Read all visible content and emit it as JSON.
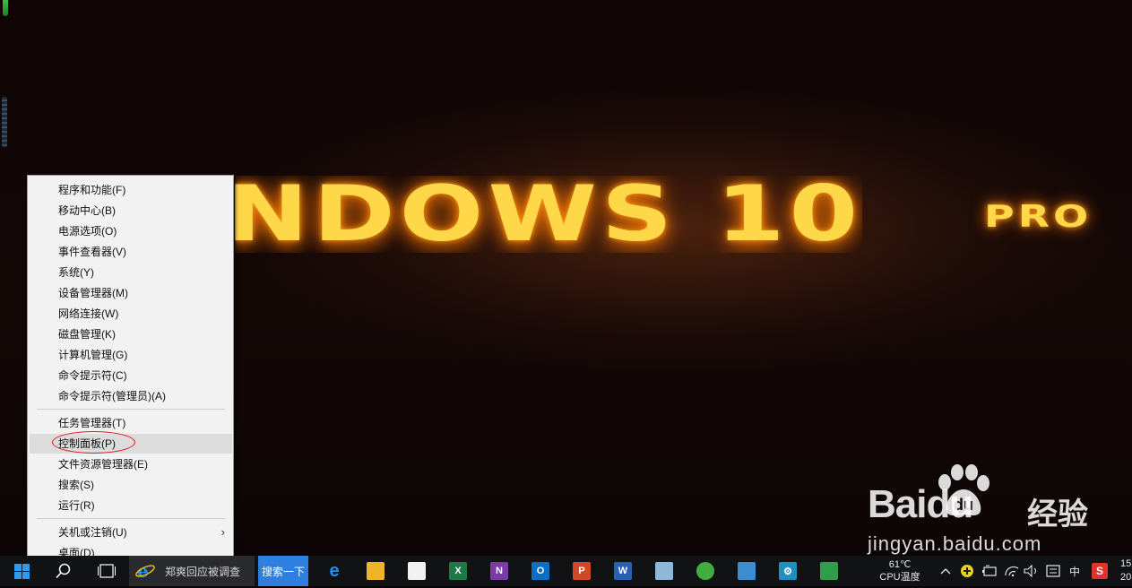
{
  "wallpaper": {
    "title": "NDOWS 10",
    "edition": "PRO"
  },
  "context_menu": {
    "groups": [
      [
        {
          "label": "程序和功能(F)"
        },
        {
          "label": "移动中心(B)"
        },
        {
          "label": "电源选项(O)"
        },
        {
          "label": "事件查看器(V)"
        },
        {
          "label": "系统(Y)"
        },
        {
          "label": "设备管理器(M)"
        },
        {
          "label": "网络连接(W)"
        },
        {
          "label": "磁盘管理(K)"
        },
        {
          "label": "计算机管理(G)"
        },
        {
          "label": "命令提示符(C)"
        },
        {
          "label": "命令提示符(管理员)(A)"
        }
      ],
      [
        {
          "label": "任务管理器(T)"
        },
        {
          "label": "控制面板(P)",
          "selected": true
        },
        {
          "label": "文件资源管理器(E)"
        },
        {
          "label": "搜索(S)"
        },
        {
          "label": "运行(R)"
        }
      ],
      [
        {
          "label": "关机或注销(U)",
          "has_submenu": true
        },
        {
          "label": "桌面(D)"
        }
      ]
    ],
    "submenu_arrow": "›"
  },
  "taskbar": {
    "start_icon": "windows-logo-icon",
    "search_icon": "magnifier-icon",
    "task_view_icon": "task-view-icon",
    "ie_window_label": "郑爽回应被调查",
    "search_button_label": "搜索一下",
    "pinned_apps": [
      {
        "name": "edge",
        "glyph": "e",
        "color": "#1e90ff"
      },
      {
        "name": "file-explorer",
        "glyph": "",
        "color": "#f0b429"
      },
      {
        "name": "store",
        "glyph": "",
        "color": "#f2f2f2"
      },
      {
        "name": "excel",
        "glyph": "X",
        "color": "#1d7a45"
      },
      {
        "name": "onenote",
        "glyph": "N",
        "color": "#7d3ba8"
      },
      {
        "name": "outlook",
        "glyph": "O",
        "color": "#0b6fc6"
      },
      {
        "name": "powerpoint",
        "glyph": "P",
        "color": "#d24726"
      },
      {
        "name": "word",
        "glyph": "W",
        "color": "#2b5fb4"
      },
      {
        "name": "paint",
        "glyph": "",
        "color": "#8fb8d8"
      },
      {
        "name": "green-app",
        "glyph": "",
        "color": "#3fae3f"
      },
      {
        "name": "remote-app",
        "glyph": "",
        "color": "#3a8dd0"
      },
      {
        "name": "settings",
        "glyph": "⚙",
        "color": "#1f8fc0"
      },
      {
        "name": "image-app",
        "glyph": "",
        "color": "#2e9e4a"
      }
    ],
    "cpu_temp_value": "61℃",
    "cpu_temp_label": "CPU温度",
    "tray": {
      "chevron": "^",
      "ime": "中",
      "sogou": "S"
    },
    "clock_time": "15",
    "clock_date": "20"
  },
  "watermark": {
    "brand": "Baidu",
    "product": "经验",
    "url": "jingyan.baidu.com"
  }
}
